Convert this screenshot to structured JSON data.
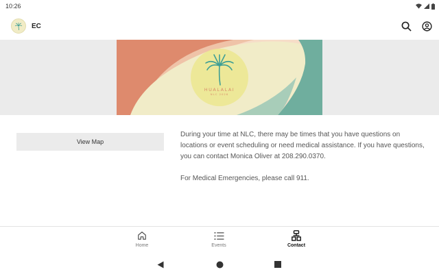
{
  "status_bar": {
    "time": "10:26"
  },
  "app_bar": {
    "title": "EC",
    "logo_icon": "palm-tree-logo",
    "actions": [
      "search-icon",
      "account-circle-icon"
    ]
  },
  "banner": {
    "line1": "HUALALAI",
    "line2": "NLC 2026",
    "colors": {
      "coral": "#de8a6d",
      "peach": "#efc3a8",
      "cream": "#f1ecc8",
      "teal": "#6fae9e",
      "palm": "#3e9e95"
    }
  },
  "main": {
    "view_map_label": "View Map",
    "info_paragraph_1": "During your time at NLC, there may be times that you have questions on locations or event scheduling or need medical assistance.  If you have questions, you can contact Monica Oliver at 208.290.0370.",
    "info_paragraph_2": "For Medical Emergencies, please call 911."
  },
  "bottom_nav": {
    "items": [
      {
        "label": "Home",
        "icon": "home-icon"
      },
      {
        "label": "Events",
        "icon": "list-icon"
      },
      {
        "label": "Contact",
        "icon": "contact-icon",
        "active": true
      }
    ]
  },
  "system_nav": [
    "back-icon",
    "home-circle-icon",
    "recents-icon"
  ]
}
